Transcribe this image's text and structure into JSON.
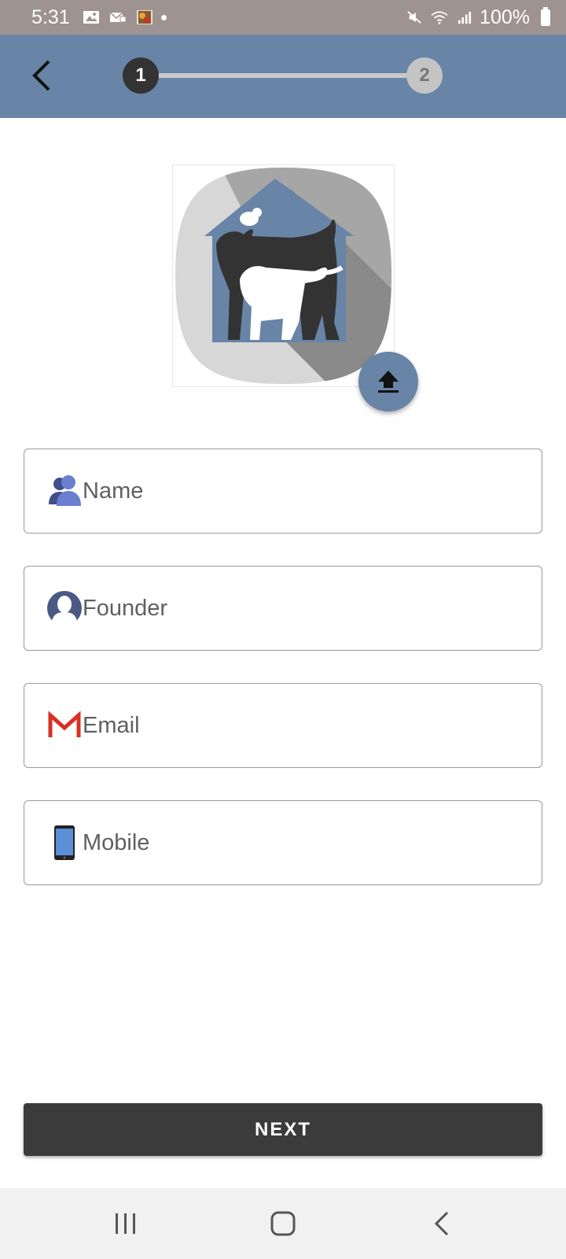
{
  "status_bar": {
    "time": "5:31",
    "battery": "100%",
    "icons": [
      "image-icon",
      "message-icon",
      "app-thumbnail-icon",
      "mute-icon",
      "wifi-icon",
      "signal-icon",
      "battery-icon"
    ]
  },
  "header": {
    "back_icon": "chevron-left-icon",
    "steps": [
      {
        "label": "1",
        "state": "active"
      },
      {
        "label": "2",
        "state": "inactive"
      }
    ]
  },
  "logo": {
    "icon": "pet-house-logo",
    "upload_icon": "upload-icon"
  },
  "form": {
    "fields": [
      {
        "placeholder": "Name",
        "icon": "group-icon"
      },
      {
        "placeholder": "Founder",
        "icon": "person-icon"
      },
      {
        "placeholder": "Email",
        "icon": "gmail-icon"
      },
      {
        "placeholder": "Mobile",
        "icon": "phone-icon"
      }
    ]
  },
  "next_label": "NEXT",
  "nav_bar": {
    "icons": [
      "recents-icon",
      "home-icon",
      "back-icon"
    ]
  },
  "colors": {
    "header": "#6884a6",
    "status_bar": "#9e9391",
    "button": "#3b3b3b",
    "step_active": "#333333",
    "step_inactive": "#c4c4c4"
  }
}
